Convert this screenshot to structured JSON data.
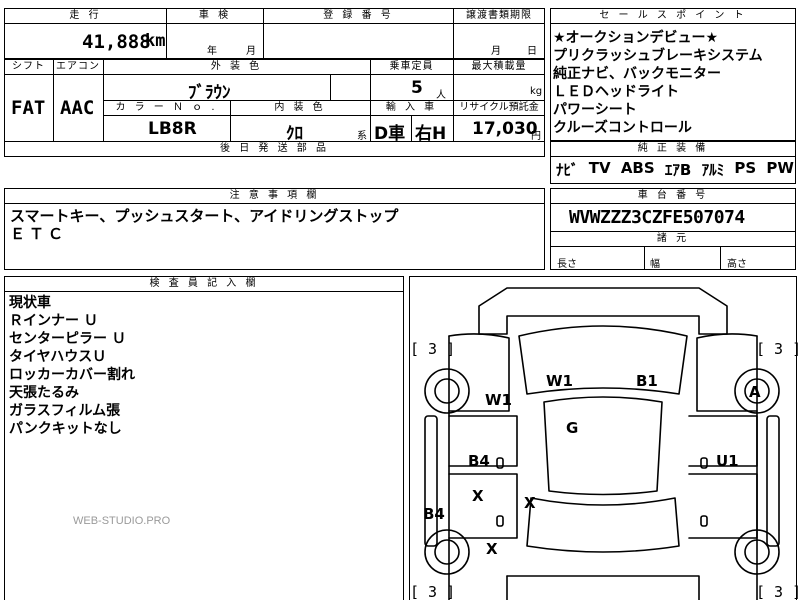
{
  "header": {
    "mileage_label": "走 行",
    "inspection_label": "車 検",
    "reg_number_label": "登 録 番 号",
    "transfer_deadline_label": "譲渡書類期限",
    "selling_points_label": "セ ー ル ス ポ イ ン ト"
  },
  "mileage": {
    "value": "41,888",
    "unit": "km"
  },
  "inspection": {
    "year_unit": "年",
    "month_unit": "月"
  },
  "transfer_deadline": {
    "month_unit": "月",
    "day_unit": "日"
  },
  "selling_points": [
    "★オークションデビュー★",
    "プリクラッシュブレーキシステム",
    "純正ナビ、バックモニター",
    "ＬＥＤヘッドライト",
    "パワーシート",
    "クルーズコントロール"
  ],
  "specs": {
    "shift_label": "シフト",
    "aircon_label": "エアコン",
    "exterior_color_label": "外 装 色",
    "capacity_label": "乗車定員",
    "max_load_label": "最大積載量",
    "shift_value": "FAT",
    "aircon_value": "AAC",
    "exterior_color_value": "ﾌﾞﾗｳﾝ",
    "capacity_value": "5",
    "capacity_unit": "人",
    "max_load_unit": "kg",
    "color_no_label": "カ ラ ー Ｎ ｏ .",
    "interior_color_label": "内 装 色",
    "import_label": "輸 入 車",
    "recycle_label": "リサイクル預託金",
    "color_no_value": "LB8R",
    "interior_color_value": "ｸﾛ",
    "interior_color_suffix": "系",
    "import_value_1": "D車",
    "import_value_2": "右H",
    "recycle_value": "17,030",
    "recycle_unit": "円",
    "later_parts_label": "後 日 発 送 部 品"
  },
  "equipment": {
    "label": "純 正 装 備",
    "items": [
      "ﾅﾋﾞ",
      "TV",
      "ABS",
      "ｴｱB",
      "ｱﾙﾐ",
      "PS",
      "PW"
    ]
  },
  "notes": {
    "label": "注 意 事 項 欄",
    "lines": [
      "スマートキー、プッシュスタート、アイドリングストップ",
      "ＥＴＣ"
    ]
  },
  "chassis": {
    "label": "車 台 番 号",
    "value": "WVWZZZ3CZFE507074",
    "dims_label": "諸 元",
    "length_label": "長さ",
    "width_label": "幅",
    "height_label": "高さ"
  },
  "inspector": {
    "label": "検 査 員 記 入 欄",
    "lines": [
      "現状車",
      "Ｒインナー Ｕ",
      "センターピラー Ｕ",
      "タイヤハウスＵ",
      "ロッカーカバー割れ",
      "天張たるみ",
      "ガラスフィルム張",
      "パンクキットなし"
    ]
  },
  "watermark": "WEB-STUDIO.PRO",
  "diagram": {
    "tire_front_left": "[ 3 ]",
    "tire_front_right": "[ 3 ]",
    "tire_rear_left": "[ 3 ]",
    "tire_rear_right": "[ 3 ]",
    "marks": {
      "windshield_left": "W1",
      "windshield_right": "B1",
      "fender_left": "W1",
      "wheel_right_front": "A",
      "roof": "G",
      "pillar_left": "B4",
      "door_right": "U1",
      "door_left_x1": "X",
      "door_left_x2": "X",
      "rocker_left": "B4",
      "rear_x": "X"
    }
  }
}
